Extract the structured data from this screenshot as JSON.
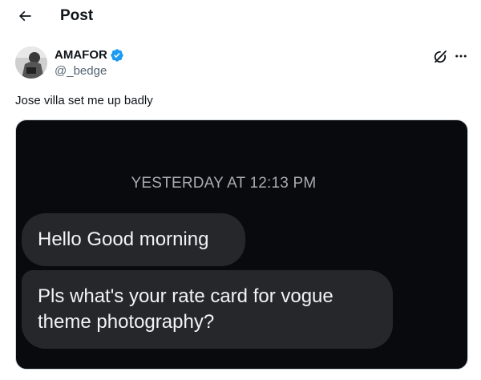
{
  "header": {
    "title": "Post",
    "back_icon": "arrow-left-icon"
  },
  "author": {
    "display_name": "AMAFOR",
    "handle": "@_bedge",
    "verified": true,
    "verified_color": "#1d9bf0"
  },
  "actions": {
    "grok_icon": "grok-icon",
    "more_icon": "more-horizontal-icon"
  },
  "post": {
    "text": "Jose villa set me up badly"
  },
  "media": {
    "timestamp": "YESTERDAY AT 12:13 PM",
    "messages": [
      {
        "text": "Hello Good morning"
      },
      {
        "text": "Pls what's your rate card for vogue theme photography?"
      }
    ]
  },
  "colors": {
    "background": "#ffffff",
    "text": "#0f1419",
    "secondary_text": "#536471",
    "media_bg": "#080a0e",
    "bubble_bg": "#26272b"
  }
}
